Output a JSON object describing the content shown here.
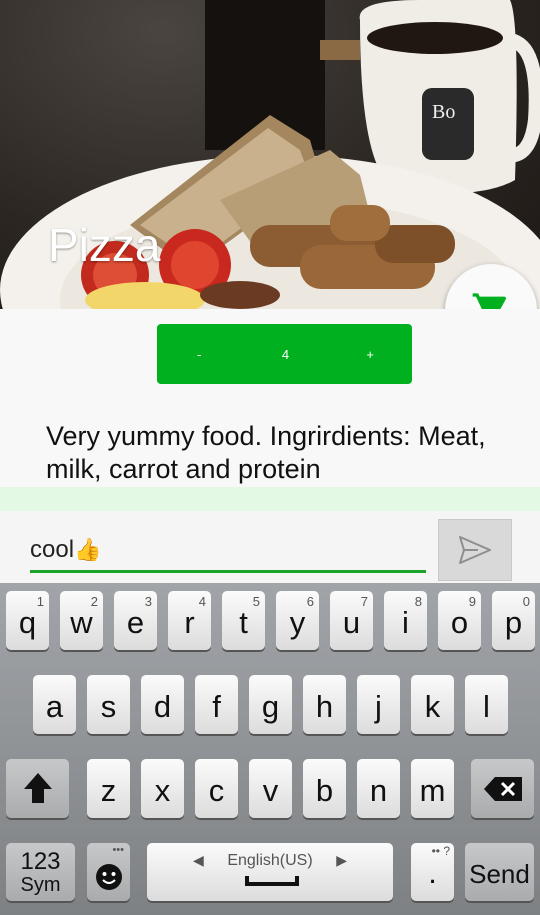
{
  "hero": {
    "title": "Pizza",
    "cart_icon": "shopping-cart-icon",
    "accent": "#00b01e"
  },
  "stepper": {
    "minus": "-",
    "value": "4",
    "plus": "+"
  },
  "description": "Very yummy food. Ingrirdients: Meat, milk, carrot and protein",
  "comment": {
    "value": "cool",
    "emoji": "👍",
    "send_icon": "send-icon"
  },
  "keyboard": {
    "row1": [
      {
        "k": "q",
        "s": "1"
      },
      {
        "k": "w",
        "s": "2"
      },
      {
        "k": "e",
        "s": "3"
      },
      {
        "k": "r",
        "s": "4"
      },
      {
        "k": "t",
        "s": "5"
      },
      {
        "k": "y",
        "s": "6"
      },
      {
        "k": "u",
        "s": "7"
      },
      {
        "k": "i",
        "s": "8"
      },
      {
        "k": "o",
        "s": "9"
      },
      {
        "k": "p",
        "s": "0"
      }
    ],
    "row2": [
      "a",
      "s",
      "d",
      "f",
      "g",
      "h",
      "j",
      "k",
      "l"
    ],
    "row3": [
      "z",
      "x",
      "c",
      "v",
      "b",
      "n",
      "m"
    ],
    "sym_top": "123",
    "sym_bottom": "Sym",
    "space_label": "English(US)",
    "period": ".",
    "send_label": "Send"
  }
}
